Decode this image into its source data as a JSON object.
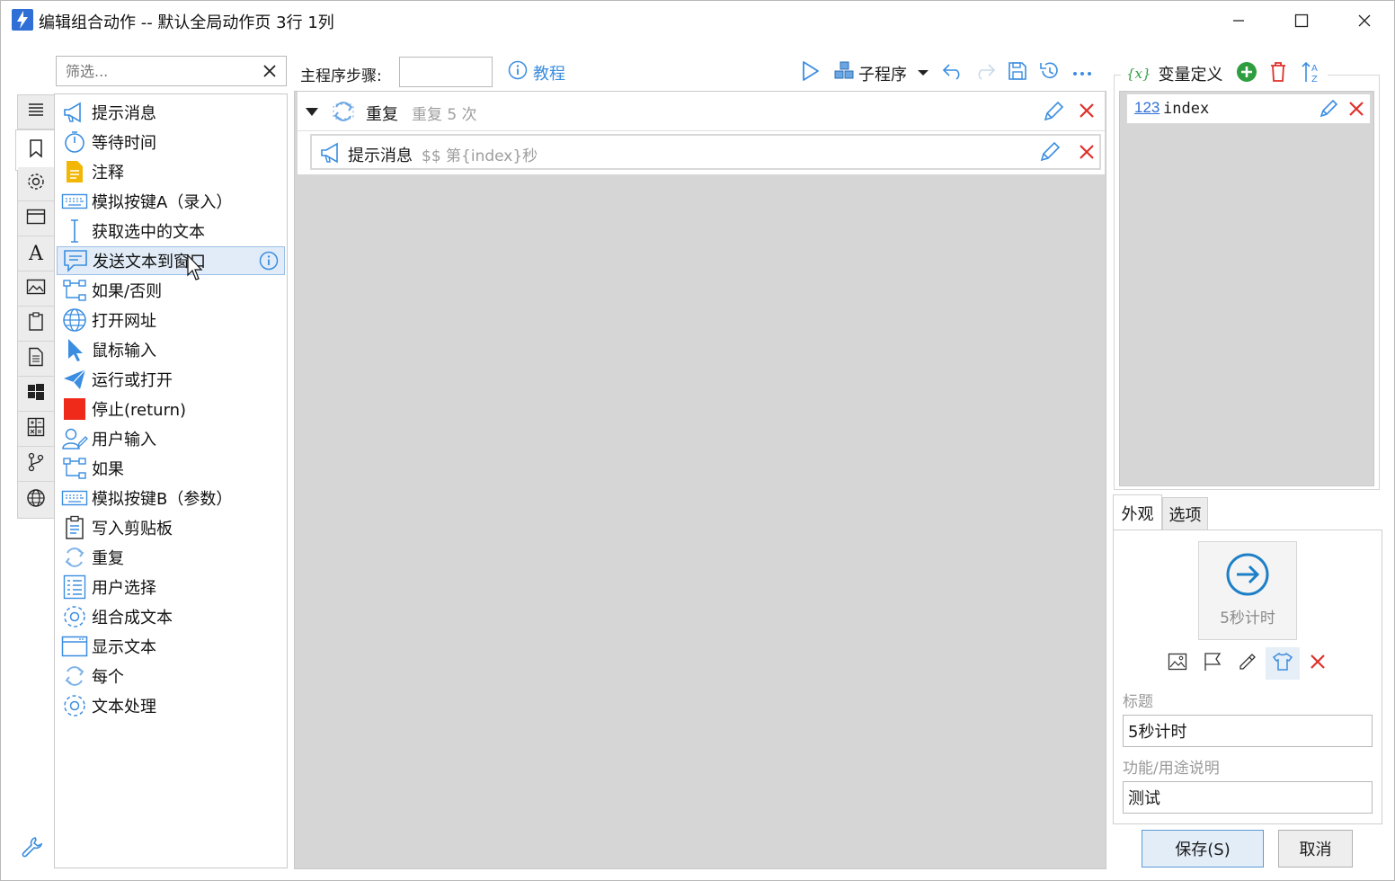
{
  "window": {
    "title": "编辑组合动作 -- 默认全局动作页 3行 1列"
  },
  "left_tabs": [
    "list-icon",
    "bookmark-icon",
    "gear-icon",
    "window-icon",
    "font-icon",
    "image-icon",
    "clipboard-icon",
    "document-icon",
    "windows-icon",
    "calculator-icon",
    "branch-icon",
    "globe-icon"
  ],
  "filter": {
    "placeholder": "筛选..."
  },
  "actions": [
    {
      "label": "提示消息",
      "icon": "megaphone-icon"
    },
    {
      "label": "等待时间",
      "icon": "stopwatch-icon"
    },
    {
      "label": "注释",
      "icon": "note-icon"
    },
    {
      "label": "模拟按键A（录入）",
      "icon": "keyboard-icon"
    },
    {
      "label": "获取选中的文本",
      "icon": "text-cursor-icon"
    },
    {
      "label": "发送文本到窗口",
      "icon": "chat-icon"
    },
    {
      "label": "如果/否则",
      "icon": "flowchart-icon"
    },
    {
      "label": "打开网址",
      "icon": "globe-icon"
    },
    {
      "label": "鼠标输入",
      "icon": "cursor-icon"
    },
    {
      "label": "运行或打开",
      "icon": "send-icon"
    },
    {
      "label": "停止(return)",
      "icon": "stop-icon"
    },
    {
      "label": "用户输入",
      "icon": "user-edit-icon"
    },
    {
      "label": "如果",
      "icon": "flowchart-icon"
    },
    {
      "label": "模拟按键B（参数）",
      "icon": "keyboard-icon"
    },
    {
      "label": "写入剪贴板",
      "icon": "clipboard-icon"
    },
    {
      "label": "重复",
      "icon": "repeat-icon"
    },
    {
      "label": "用户选择",
      "icon": "checklist-icon"
    },
    {
      "label": "组合成文本",
      "icon": "gear-icon"
    },
    {
      "label": "显示文本",
      "icon": "window-icon"
    },
    {
      "label": "每个",
      "icon": "repeat-icon"
    },
    {
      "label": "文本处理",
      "icon": "gear-icon"
    }
  ],
  "selected_action": "发送文本到窗口",
  "main": {
    "steps_label": "主程序步骤:",
    "steps_value": "",
    "tutorial_label": "教程",
    "subprogram_label": "子程序"
  },
  "steps": [
    {
      "name": "重复",
      "detail": "重复 5 次",
      "icon": "repeat-icon"
    },
    {
      "name": "提示消息",
      "detail": "$$ 第{index}秒",
      "icon": "megaphone-icon"
    }
  ],
  "variables": {
    "header": "变量定义",
    "header_prefix": "{x}",
    "items": [
      {
        "type_badge": "123",
        "name": "index"
      }
    ]
  },
  "right_tabs": {
    "appearance": "外观",
    "options": "选项"
  },
  "appearance": {
    "preview_label": "5秒计时",
    "title_label": "标题",
    "title_value": "5秒计时",
    "desc_label": "功能/用途说明",
    "desc_value": "测试"
  },
  "buttons": {
    "save": "保存(S)",
    "cancel": "取消"
  },
  "colors": {
    "accent_blue": "#3a8de0",
    "delete_red": "#e0302a",
    "add_green": "#2e9e3f",
    "stop_red": "#f02a1a",
    "steps_bg": "#d6d6d6"
  }
}
